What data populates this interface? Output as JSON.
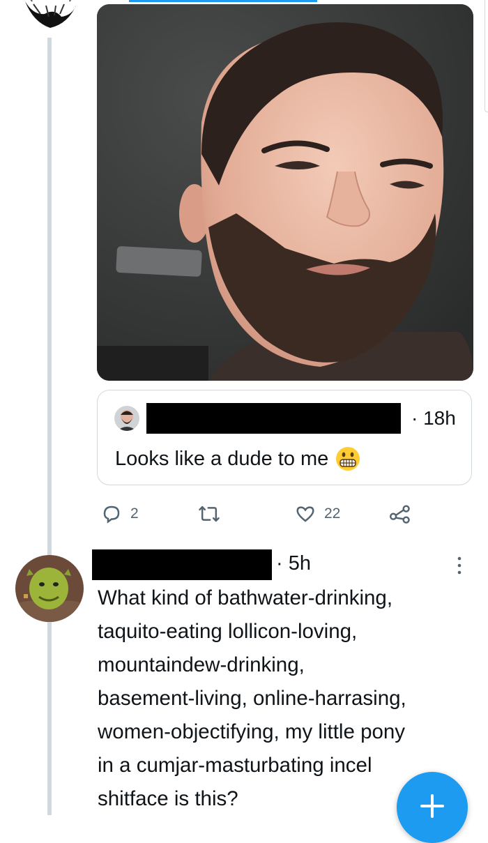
{
  "quoted_tweet": {
    "time": "· 18h",
    "text": "Looks like a dude to me"
  },
  "actions": {
    "reply_count": "2",
    "retweet_count": "",
    "like_count": "22"
  },
  "reply_tweet": {
    "time": "· 5h",
    "lines": [
      "What kind of bathwater-drinking,",
      "taquito-eating lollicon-loving,",
      "mountaindew-drinking,",
      "basement-living, online-harrasing,",
      "women-objectifying, my little pony",
      "in a cumjar-masturbating incel",
      "shitface is this?"
    ]
  },
  "icons": {
    "reply": "comment-icon",
    "retweet": "retweet-icon",
    "like": "heart-icon",
    "share": "share-icon",
    "more": "more-vertical-icon",
    "compose": "plus-icon"
  },
  "colors": {
    "accent": "#1d9bf0",
    "muted": "#536471",
    "thread_line": "#cfd9de"
  }
}
